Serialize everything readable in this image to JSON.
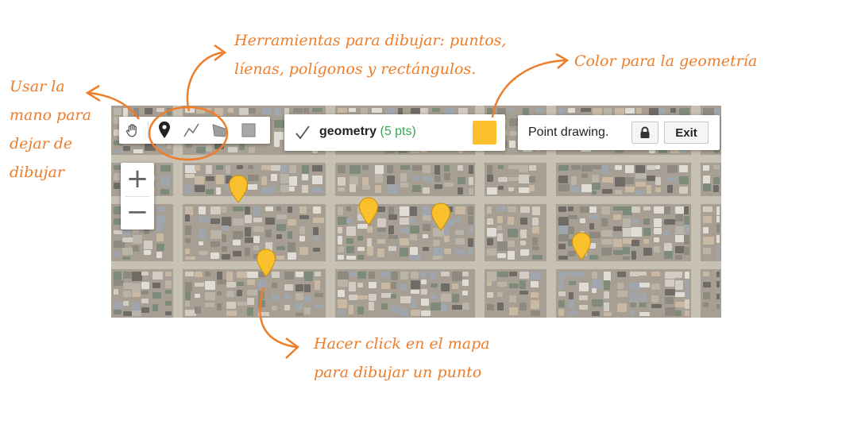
{
  "annotations": {
    "hand": [
      "Usar la",
      "mano para",
      "dejar de",
      "dibujar"
    ],
    "tools": [
      "Herramientas para dibujar: puntos,",
      "líenas, polígonos y rectángulos."
    ],
    "color": "Color para la geometría",
    "click": [
      "Hacer click en el mapa",
      "para dibujar un punto"
    ]
  },
  "layer": {
    "name": "geometry",
    "count": "(5 pts)",
    "color": "#fbc02d",
    "count_color": "#34a853"
  },
  "mode": {
    "label": "Point drawing.",
    "exit": "Exit"
  },
  "zoom": {
    "in": "+",
    "out": "−"
  },
  "colors": {
    "accent": "#ee7d2a",
    "marker": "#fbc02d"
  },
  "icons": [
    "hand-icon",
    "marker-tool-icon",
    "line-tool-icon",
    "polygon-tool-icon",
    "rectangle-tool-icon",
    "checkmark-icon",
    "lock-icon"
  ]
}
